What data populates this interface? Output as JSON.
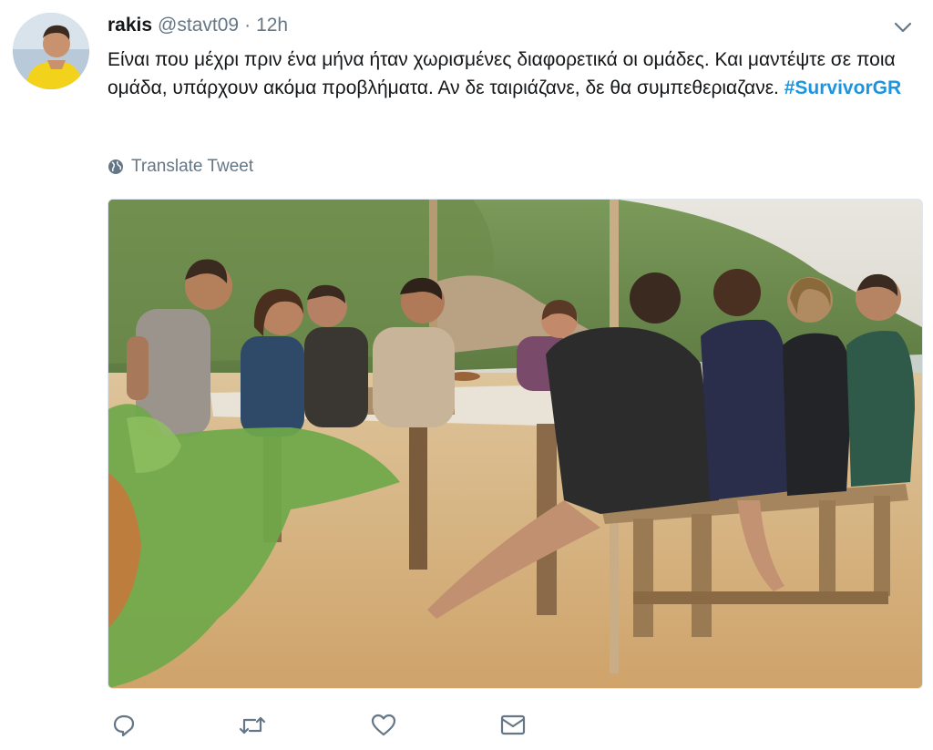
{
  "user": {
    "name": "rakis",
    "handle": "@stavt09",
    "separator": "·",
    "time": "12h"
  },
  "tweet": {
    "text_before": "Είναι που μέχρι πριν ένα μήνα ήταν χωρισμένες διαφορετικά οι ομάδες. Και μαντέψτε σε ποια ομάδα, υπάρχουν ακόμα προβλήματα. Αν δε ταιριάζανε, δε θα συμπεθεριαζανε. ",
    "hashtag": "#SurvivorGR"
  },
  "translate_label": "Translate Tweet",
  "colors": {
    "hashtag": "#1b95e0",
    "muted": "#657786",
    "text": "#14171a"
  },
  "actions": [
    {
      "icon": "reply-icon"
    },
    {
      "icon": "retweet-icon"
    },
    {
      "icon": "like-icon"
    },
    {
      "icon": "direct-message-icon"
    }
  ]
}
